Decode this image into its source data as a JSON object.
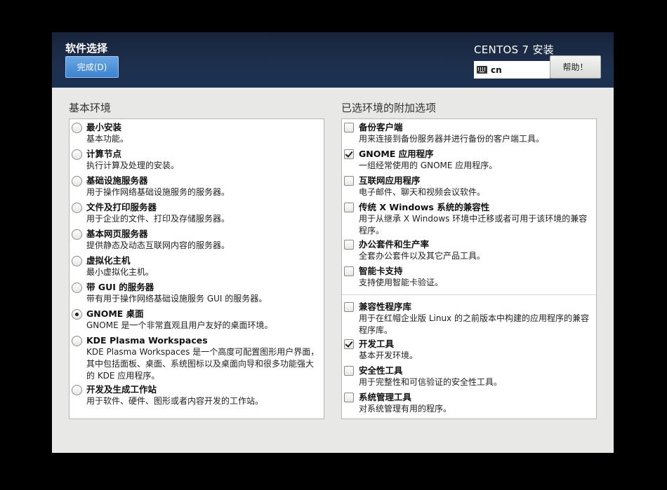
{
  "header": {
    "title": "软件选择",
    "done_label": "完成(D)",
    "product": "CENTOS 7 安装",
    "keyboard_layout": "cn",
    "help_label": "帮助！"
  },
  "base_env": {
    "title": "基本环境",
    "items": [
      {
        "label": "最小安装",
        "desc": "基本功能。",
        "selected": false
      },
      {
        "label": "计算节点",
        "desc": "执行计算及处理的安装。",
        "selected": false
      },
      {
        "label": "基础设施服务器",
        "desc": "用于操作网络基础设施服务的服务器。",
        "selected": false
      },
      {
        "label": "文件及打印服务器",
        "desc": "用于企业的文件、打印及存储服务器。",
        "selected": false
      },
      {
        "label": "基本网页服务器",
        "desc": "提供静态及动态互联网内容的服务器。",
        "selected": false
      },
      {
        "label": "虚拟化主机",
        "desc": "最小虚拟化主机。",
        "selected": false
      },
      {
        "label": "带 GUI 的服务器",
        "desc": "带有用于操作网络基础设施服务 GUI 的服务器。",
        "selected": false
      },
      {
        "label": "GNOME 桌面",
        "desc": "GNOME 是一个非常直观且用户友好的桌面环境。",
        "selected": true
      },
      {
        "label": "KDE Plasma Workspaces",
        "desc": "KDE Plasma Workspaces 是一个高度可配置图形用户界面，其中包括面板、桌面、系统图标以及桌面向导和很多功能强大的 KDE 应用程序。",
        "selected": false
      },
      {
        "label": "开发及生成工作站",
        "desc": "用于软件、硬件、图形或者内容开发的工作站。",
        "selected": false
      }
    ]
  },
  "addons": {
    "title": "已选环境的附加选项",
    "group1": [
      {
        "label": "备份客户端",
        "desc": "用来连接到备份服务器并进行备份的客户端工具。",
        "checked": false
      },
      {
        "label": "GNOME 应用程序",
        "desc": "一组经常使用的 GNOME 应用程序。",
        "checked": true
      },
      {
        "label": "互联网应用程序",
        "desc": "电子邮件、聊天和视频会议软件。",
        "checked": false
      },
      {
        "label": "传统 X Windows 系统的兼容性",
        "desc": "用于从继承 X Windows 环境中迁移或者可用于该环境的兼容程序。",
        "checked": false
      },
      {
        "label": "办公套件和生产率",
        "desc": "全套办公套件以及其它产品工具。",
        "checked": false
      },
      {
        "label": "智能卡支持",
        "desc": "支持使用智能卡验证。",
        "checked": false
      }
    ],
    "group2": [
      {
        "label": "兼容性程序库",
        "desc": "用于在红帽企业版 Linux 的之前版本中构建的应用程序的兼容程序库。",
        "checked": false
      },
      {
        "label": "开发工具",
        "desc": "基本开发环境。",
        "checked": true
      },
      {
        "label": "安全性工具",
        "desc": "用于完整性和可信验证的安全性工具。",
        "checked": false
      },
      {
        "label": "系统管理工具",
        "desc": "对系统管理有用的程序。",
        "checked": false
      }
    ]
  }
}
